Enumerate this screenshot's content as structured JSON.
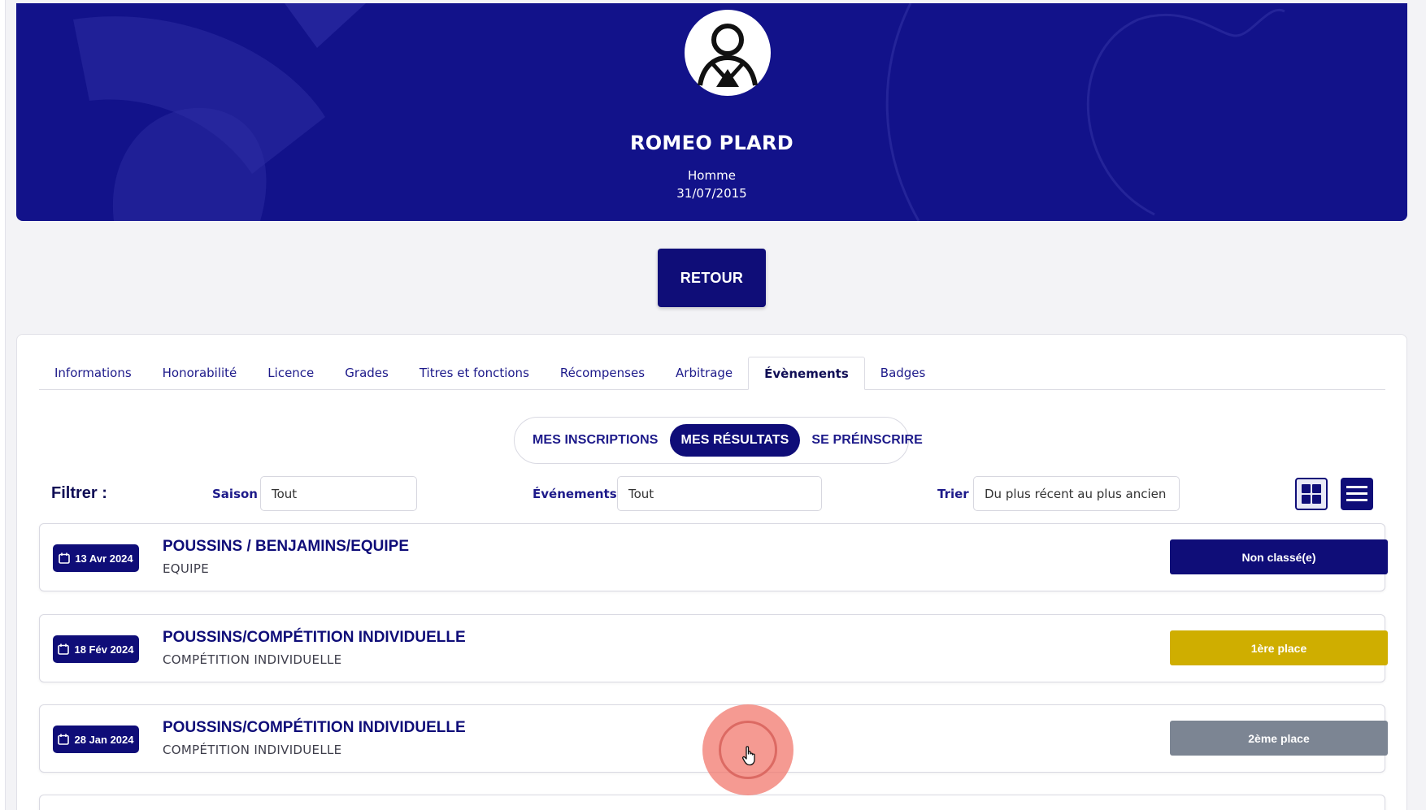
{
  "profile": {
    "name": "ROMEO PLARD",
    "gender": "Homme",
    "birthdate": "31/07/2015",
    "avatar_icon": "user-avatar-icon"
  },
  "back_button": "RETOUR",
  "tabs": [
    {
      "label": "Informations",
      "active": false
    },
    {
      "label": "Honorabilité",
      "active": false
    },
    {
      "label": "Licence",
      "active": false
    },
    {
      "label": "Grades",
      "active": false
    },
    {
      "label": "Titres et fonctions",
      "active": false
    },
    {
      "label": "Récompenses",
      "active": false
    },
    {
      "label": "Arbitrage",
      "active": false
    },
    {
      "label": "Évènements",
      "active": true
    },
    {
      "label": "Badges",
      "active": false
    }
  ],
  "segments": [
    {
      "label": "MES INSCRIPTIONS",
      "active": false
    },
    {
      "label": "MES RÉSULTATS",
      "active": true
    },
    {
      "label": "SE PRÉINSCRIRE",
      "active": false
    }
  ],
  "filters": {
    "title": "Filtrer :",
    "season_label": "Saison",
    "season_value": "Tout",
    "events_label": "Événements",
    "events_value": "Tout",
    "sort_label": "Trier",
    "sort_value": "Du plus récent au plus ancien",
    "grid_view_icon": "grid-view-icon",
    "list_view_icon": "list-view-icon"
  },
  "events": [
    {
      "date": "13 Avr 2024",
      "title": "POUSSINS / BENJAMINS/EQUIPE",
      "subtitle": "EQUIPE",
      "result": "Non classé(e)",
      "result_color": "#0f0d78"
    },
    {
      "date": "18 Fév 2024",
      "title": "POUSSINS/COMPÉTITION INDIVIDUELLE",
      "subtitle": "COMPÉTITION INDIVIDUELLE",
      "result": "1ère place",
      "result_color": "#cfae00"
    },
    {
      "date": "28 Jan 2024",
      "title": "POUSSINS/COMPÉTITION INDIVIDUELLE",
      "subtitle": "COMPÉTITION INDIVIDUELLE",
      "result": "2ème place",
      "result_color": "#7c8593"
    }
  ],
  "colors": {
    "brand": "#0f0d78",
    "banner": "#12128a",
    "background": "#f3f3f6"
  }
}
